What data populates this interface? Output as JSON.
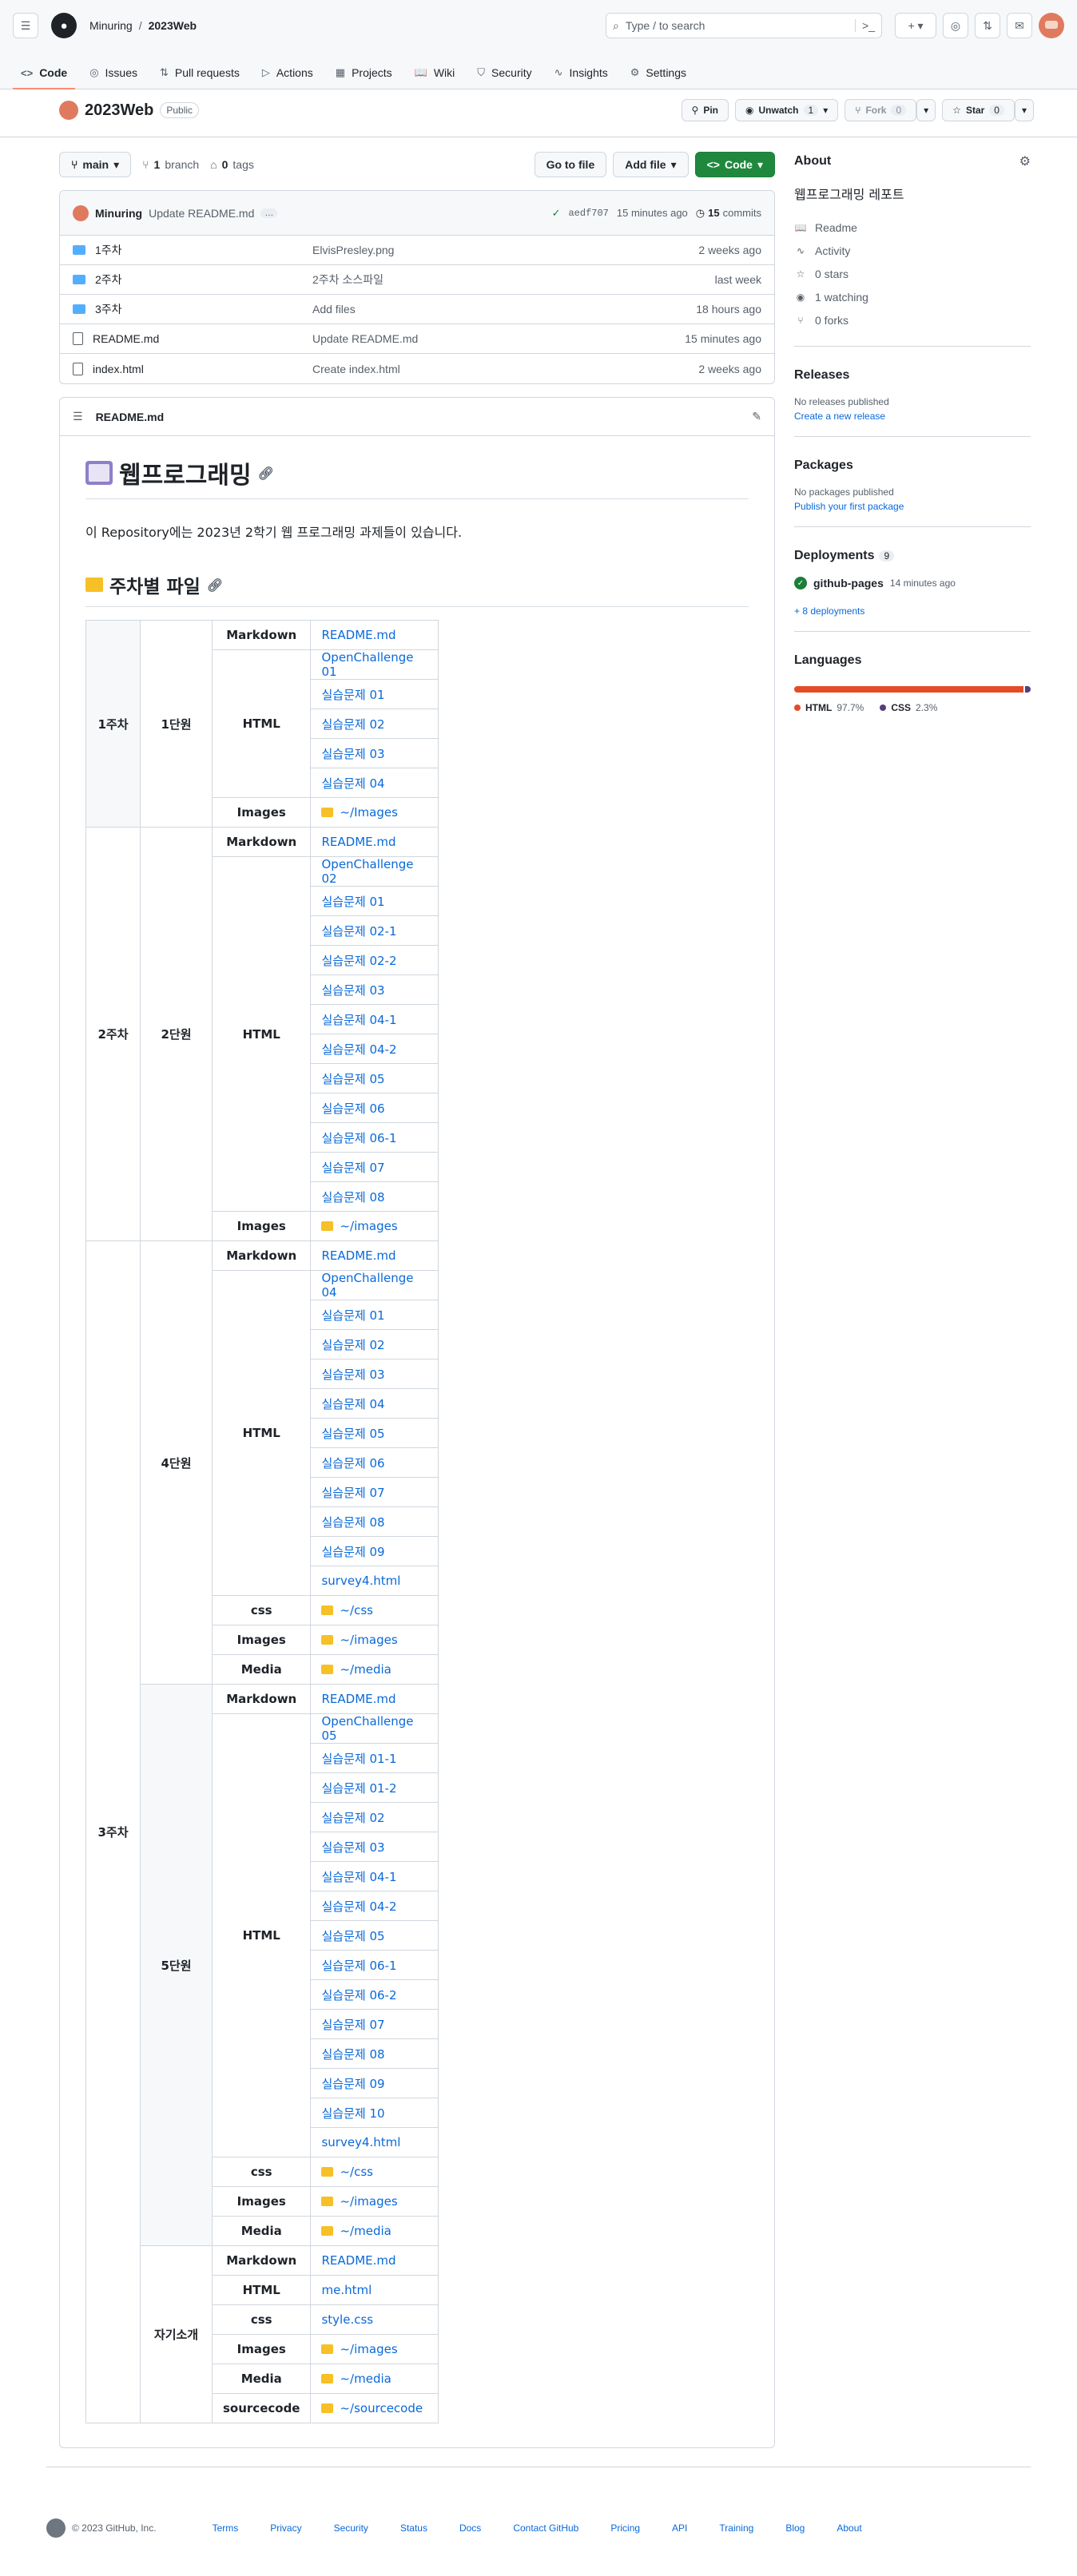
{
  "header": {
    "owner": "Minuring",
    "repo": "2023Web",
    "search_placeholder": "Type / to search",
    "slash": "/"
  },
  "tabs": [
    {
      "label": "Code",
      "icon": "<>"
    },
    {
      "label": "Issues",
      "icon": "◎"
    },
    {
      "label": "Pull requests",
      "icon": "⇅"
    },
    {
      "label": "Actions",
      "icon": "▷"
    },
    {
      "label": "Projects",
      "icon": "▦"
    },
    {
      "label": "Wiki",
      "icon": "📖"
    },
    {
      "label": "Security",
      "icon": "⛉"
    },
    {
      "label": "Insights",
      "icon": "∿"
    },
    {
      "label": "Settings",
      "icon": "⚙"
    }
  ],
  "repo": {
    "name": "2023Web",
    "visibility": "Public",
    "pin": "Pin",
    "unwatch": "Unwatch",
    "watch_count": "1",
    "fork": "Fork",
    "fork_count": "0",
    "star": "Star",
    "star_count": "0"
  },
  "branch_bar": {
    "branch": "main",
    "branches_count": "1",
    "branches_label": "branch",
    "tags_count": "0",
    "tags_label": "tags",
    "goto": "Go to file",
    "add": "Add file",
    "code": "Code"
  },
  "commit": {
    "author": "Minuring",
    "message": "Update README.md",
    "dots": "…",
    "sha": "aedf707",
    "time": "15 minutes ago",
    "commits_count": "15",
    "commits_label": "commits"
  },
  "files": [
    {
      "name": "1주차",
      "type": "folder",
      "msg": "ElvisPresley.png",
      "time": "2 weeks ago"
    },
    {
      "name": "2주차",
      "type": "folder",
      "msg": "2주차 소스파일",
      "time": "last week"
    },
    {
      "name": "3주차",
      "type": "folder",
      "msg": "Add files",
      "time": "18 hours ago"
    },
    {
      "name": "README.md",
      "type": "file",
      "msg": "Update README.md",
      "time": "15 minutes ago"
    },
    {
      "name": "index.html",
      "type": "file",
      "msg": "Create index.html",
      "time": "2 weeks ago"
    }
  ],
  "readme": {
    "filename": "README.md",
    "title": "웹프로그래밍",
    "intro": "이 Repository에는 2023년 2학기 웹 프로그래밍 과제들이 있습니다.",
    "section": "주차별 파일",
    "weeks": [
      "1주차",
      "2주차",
      "3주차"
    ],
    "units": [
      "1단원",
      "2단원",
      "4단원",
      "5단원",
      "자기소개"
    ],
    "types": {
      "md": "Markdown",
      "html": "HTML",
      "css": "css",
      "images": "Images",
      "media": "Media",
      "source": "sourcecode"
    },
    "u1": {
      "md": "README.md",
      "html": [
        "OpenChallenge 01",
        "실습문제 01",
        "실습문제 02",
        "실습문제 03",
        "실습문제 04"
      ],
      "images": "~/Images"
    },
    "u2": {
      "md": "README.md",
      "html": [
        "OpenChallenge 02",
        "실습문제 01",
        "실습문제 02-1",
        "실습문제 02-2",
        "실습문제 03",
        "실습문제 04-1",
        "실습문제 04-2",
        "실습문제 05",
        "실습문제 06",
        "실습문제 06-1",
        "실습문제 07",
        "실습문제 08"
      ],
      "images": "~/images"
    },
    "u4": {
      "md": "README.md",
      "html": [
        "OpenChallenge 04",
        "실습문제 01",
        "실습문제 02",
        "실습문제 03",
        "실습문제 04",
        "실습문제 05",
        "실습문제 06",
        "실습문제 07",
        "실습문제 08",
        "실습문제 09",
        "survey4.html"
      ],
      "css": "~/css",
      "images": "~/images",
      "media": "~/media"
    },
    "u5": {
      "md": "README.md",
      "html": [
        "OpenChallenge 05",
        "실습문제 01-1",
        "실습문제 01-2",
        "실습문제 02",
        "실습문제 03",
        "실습문제 04-1",
        "실습문제 04-2",
        "실습문제 05",
        "실습문제 06-1",
        "실습문제 06-2",
        "실습문제 07",
        "실습문제 08",
        "실습문제 09",
        "실습문제 10",
        "survey4.html"
      ],
      "css": "~/css",
      "images": "~/images",
      "media": "~/media"
    },
    "intro_unit": {
      "md": "README.md",
      "html": "me.html",
      "css": "style.css",
      "images": "~/images",
      "media": "~/media",
      "source": "~/sourcecode"
    }
  },
  "about": {
    "heading": "About",
    "description": "웹프로그래밍 레포트",
    "items": [
      {
        "icon": "📖",
        "label": "Readme"
      },
      {
        "icon": "∿",
        "label": "Activity"
      },
      {
        "icon": "☆",
        "label": "0 stars"
      },
      {
        "icon": "◉",
        "label": "1 watching"
      },
      {
        "icon": "⑂",
        "label": "0 forks"
      }
    ]
  },
  "releases": {
    "heading": "Releases",
    "none": "No releases published",
    "create": "Create a new release"
  },
  "packages": {
    "heading": "Packages",
    "none": "No packages published",
    "publish": "Publish your first package"
  },
  "deployments": {
    "heading": "Deployments",
    "count": "9",
    "env": "github-pages",
    "time": "14 minutes ago",
    "more": "+ 8 deployments"
  },
  "languages": {
    "heading": "Languages",
    "items": [
      {
        "name": "HTML",
        "percent": "97.7%",
        "value": 97.7,
        "color": "#e34c26"
      },
      {
        "name": "CSS",
        "percent": "2.3%",
        "value": 2.3,
        "color": "#563d7c"
      }
    ]
  },
  "footer": {
    "copyright": "© 2023 GitHub, Inc.",
    "links": [
      "Terms",
      "Privacy",
      "Security",
      "Status",
      "Docs",
      "Contact GitHub",
      "Pricing",
      "API",
      "Training",
      "Blog",
      "About"
    ]
  }
}
